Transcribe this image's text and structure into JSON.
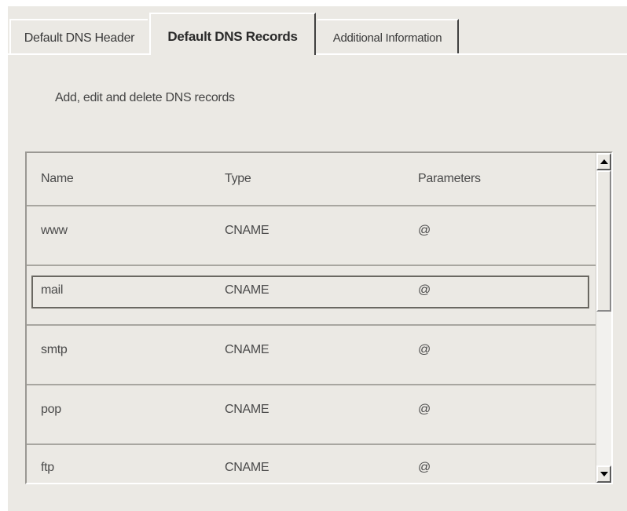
{
  "tabs": {
    "header": "Default DNS Header",
    "records": "Default DNS Records",
    "additional": "Additional Information"
  },
  "description": "Add, edit and delete DNS records",
  "columns": {
    "name": "Name",
    "type": "Type",
    "parameters": "Parameters"
  },
  "rows": [
    {
      "name": "www",
      "type": "CNAME",
      "parameters": "@"
    },
    {
      "name": "mail",
      "type": "CNAME",
      "parameters": "@"
    },
    {
      "name": "smtp",
      "type": "CNAME",
      "parameters": "@"
    },
    {
      "name": "pop",
      "type": "CNAME",
      "parameters": "@"
    },
    {
      "name": "ftp",
      "type": "CNAME",
      "parameters": "@"
    }
  ],
  "selected_row": "mail",
  "icons": {
    "scroll_up": "arrow-up-icon",
    "scroll_down": "arrow-down-icon"
  },
  "colors": {
    "background": "#ebe9e4",
    "text": "#4a4a4a"
  }
}
